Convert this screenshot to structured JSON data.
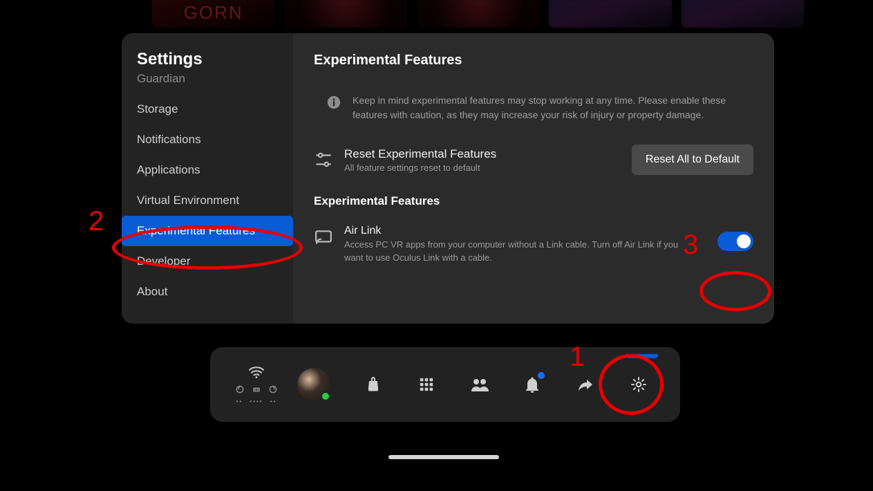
{
  "bg": {
    "tile1": "GORN"
  },
  "sidebar": {
    "title": "Settings",
    "items": [
      {
        "label": "Guardian"
      },
      {
        "label": "Storage"
      },
      {
        "label": "Notifications"
      },
      {
        "label": "Applications"
      },
      {
        "label": "Virtual Environment"
      },
      {
        "label": "Experimental Features"
      },
      {
        "label": "Developer"
      },
      {
        "label": "About"
      }
    ],
    "active_index": 5
  },
  "content": {
    "title": "Experimental Features",
    "info_text": "Keep in mind experimental features may stop working at any time. Please enable these features with caution, as they may increase your risk of injury or property damage.",
    "reset": {
      "title": "Reset Experimental Features",
      "subtitle": "All feature settings reset to default",
      "button": "Reset All to Default"
    },
    "section_label": "Experimental Features",
    "air_link": {
      "title": "Air Link",
      "subtitle": "Access PC VR apps from your computer without a Link cable. Turn off Air Link if you want to use Oculus Link with a cable.",
      "enabled": true
    }
  },
  "annotations": {
    "n1": "1",
    "n2": "2",
    "n3": "3"
  }
}
